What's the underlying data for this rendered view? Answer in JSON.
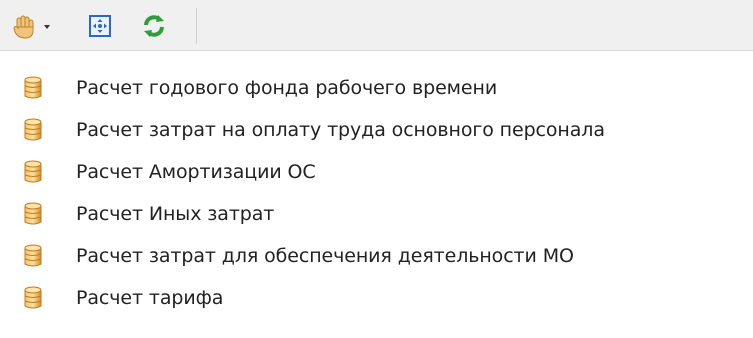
{
  "toolbar": {
    "buttons": [
      {
        "icon": "hand-pan-icon",
        "dropdown": true
      },
      {
        "icon": "fit-to-window-icon"
      },
      {
        "icon": "refresh-icon"
      }
    ]
  },
  "list": {
    "icon": "database-icon",
    "items": [
      {
        "label": "Расчет годового фонда рабочего времени"
      },
      {
        "label": "Расчет затрат на оплату труда основного персонала"
      },
      {
        "label": "Расчет Амортизации ОС"
      },
      {
        "label": "Расчет Иных затрат"
      },
      {
        "label": "Расчет затрат для обеспечения деятельности МО"
      },
      {
        "label": "Расчет тарифа"
      }
    ]
  },
  "colors": {
    "toolbar_bg": "#f0f0f0",
    "db_icon": "#e8a23c",
    "refresh": "#2e9d3a",
    "fit_frame": "#2b67c9"
  }
}
